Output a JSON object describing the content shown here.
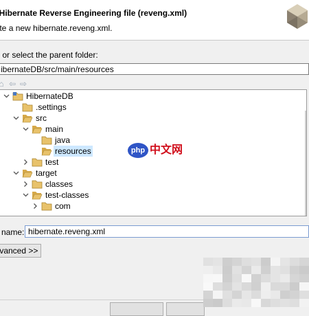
{
  "banner": {
    "title": "ate Hibernate Reverse Engineering file (reveng.xml)",
    "description": "eate a new hibernate.reveng.xml."
  },
  "parent_folder": {
    "label": "ter or select the parent folder:",
    "value": "ibernateDB/src/main/resources"
  },
  "tree": {
    "items": [
      {
        "label": "HibernateDB",
        "depth": 0,
        "twisty": "expanded",
        "icon": "project-icon"
      },
      {
        "label": ".settings",
        "depth": 1,
        "twisty": "none",
        "icon": "folder-icon"
      },
      {
        "label": "src",
        "depth": 1,
        "twisty": "expanded",
        "icon": "folder-open-icon"
      },
      {
        "label": "main",
        "depth": 2,
        "twisty": "expanded",
        "icon": "folder-open-icon"
      },
      {
        "label": "java",
        "depth": 3,
        "twisty": "none",
        "icon": "folder-icon"
      },
      {
        "label": "resources",
        "depth": 3,
        "twisty": "none",
        "icon": "folder-open-icon",
        "selected": true
      },
      {
        "label": "test",
        "depth": 2,
        "twisty": "collapsed",
        "icon": "folder-icon"
      },
      {
        "label": "target",
        "depth": 1,
        "twisty": "expanded",
        "icon": "folder-open-icon"
      },
      {
        "label": "classes",
        "depth": 2,
        "twisty": "collapsed",
        "icon": "folder-icon"
      },
      {
        "label": "test-classes",
        "depth": 2,
        "twisty": "expanded",
        "icon": "folder-open-icon"
      },
      {
        "label": "com",
        "depth": 3,
        "twisty": "collapsed",
        "icon": "folder-icon"
      }
    ]
  },
  "file_name": {
    "label": "e name:",
    "value": "hibernate.reveng.xml"
  },
  "advanced_button": "dvanced >>",
  "watermark": {
    "badge": "php",
    "text": "中文网"
  },
  "colors": {
    "selection": "#cde8ff",
    "folder": "#e8c26b",
    "watermark_blue": "#2f55c6",
    "watermark_red": "#d10f1c"
  }
}
